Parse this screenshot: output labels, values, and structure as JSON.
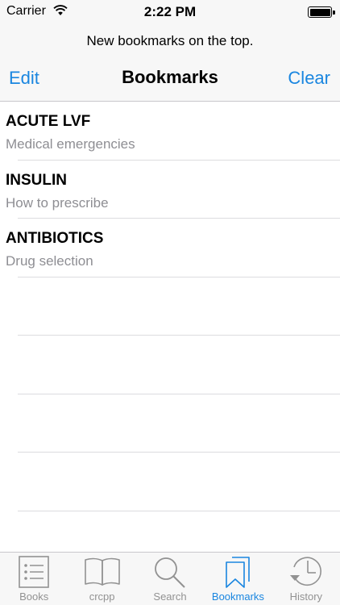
{
  "status": {
    "carrier": "Carrier",
    "time": "2:22 PM"
  },
  "header": {
    "prompt": "New bookmarks on the top.",
    "edit_label": "Edit",
    "title": "Bookmarks",
    "clear_label": "Clear"
  },
  "bookmarks": [
    {
      "title": "ACUTE LVF",
      "subtitle": "Medical emergencies"
    },
    {
      "title": "INSULIN",
      "subtitle": "How to prescribe"
    },
    {
      "title": "ANTIBIOTICS",
      "subtitle": "Drug selection"
    }
  ],
  "tabs": [
    {
      "label": "Books",
      "icon": "list-icon"
    },
    {
      "label": "crcpp",
      "icon": "book-icon"
    },
    {
      "label": "Search",
      "icon": "search-icon"
    },
    {
      "label": "Bookmarks",
      "icon": "bookmarks-icon",
      "active": true
    },
    {
      "label": "History",
      "icon": "clock-icon"
    }
  ],
  "colors": {
    "accent": "#1a86e0",
    "inactive": "#929292",
    "bar_background": "#f7f7f7"
  }
}
